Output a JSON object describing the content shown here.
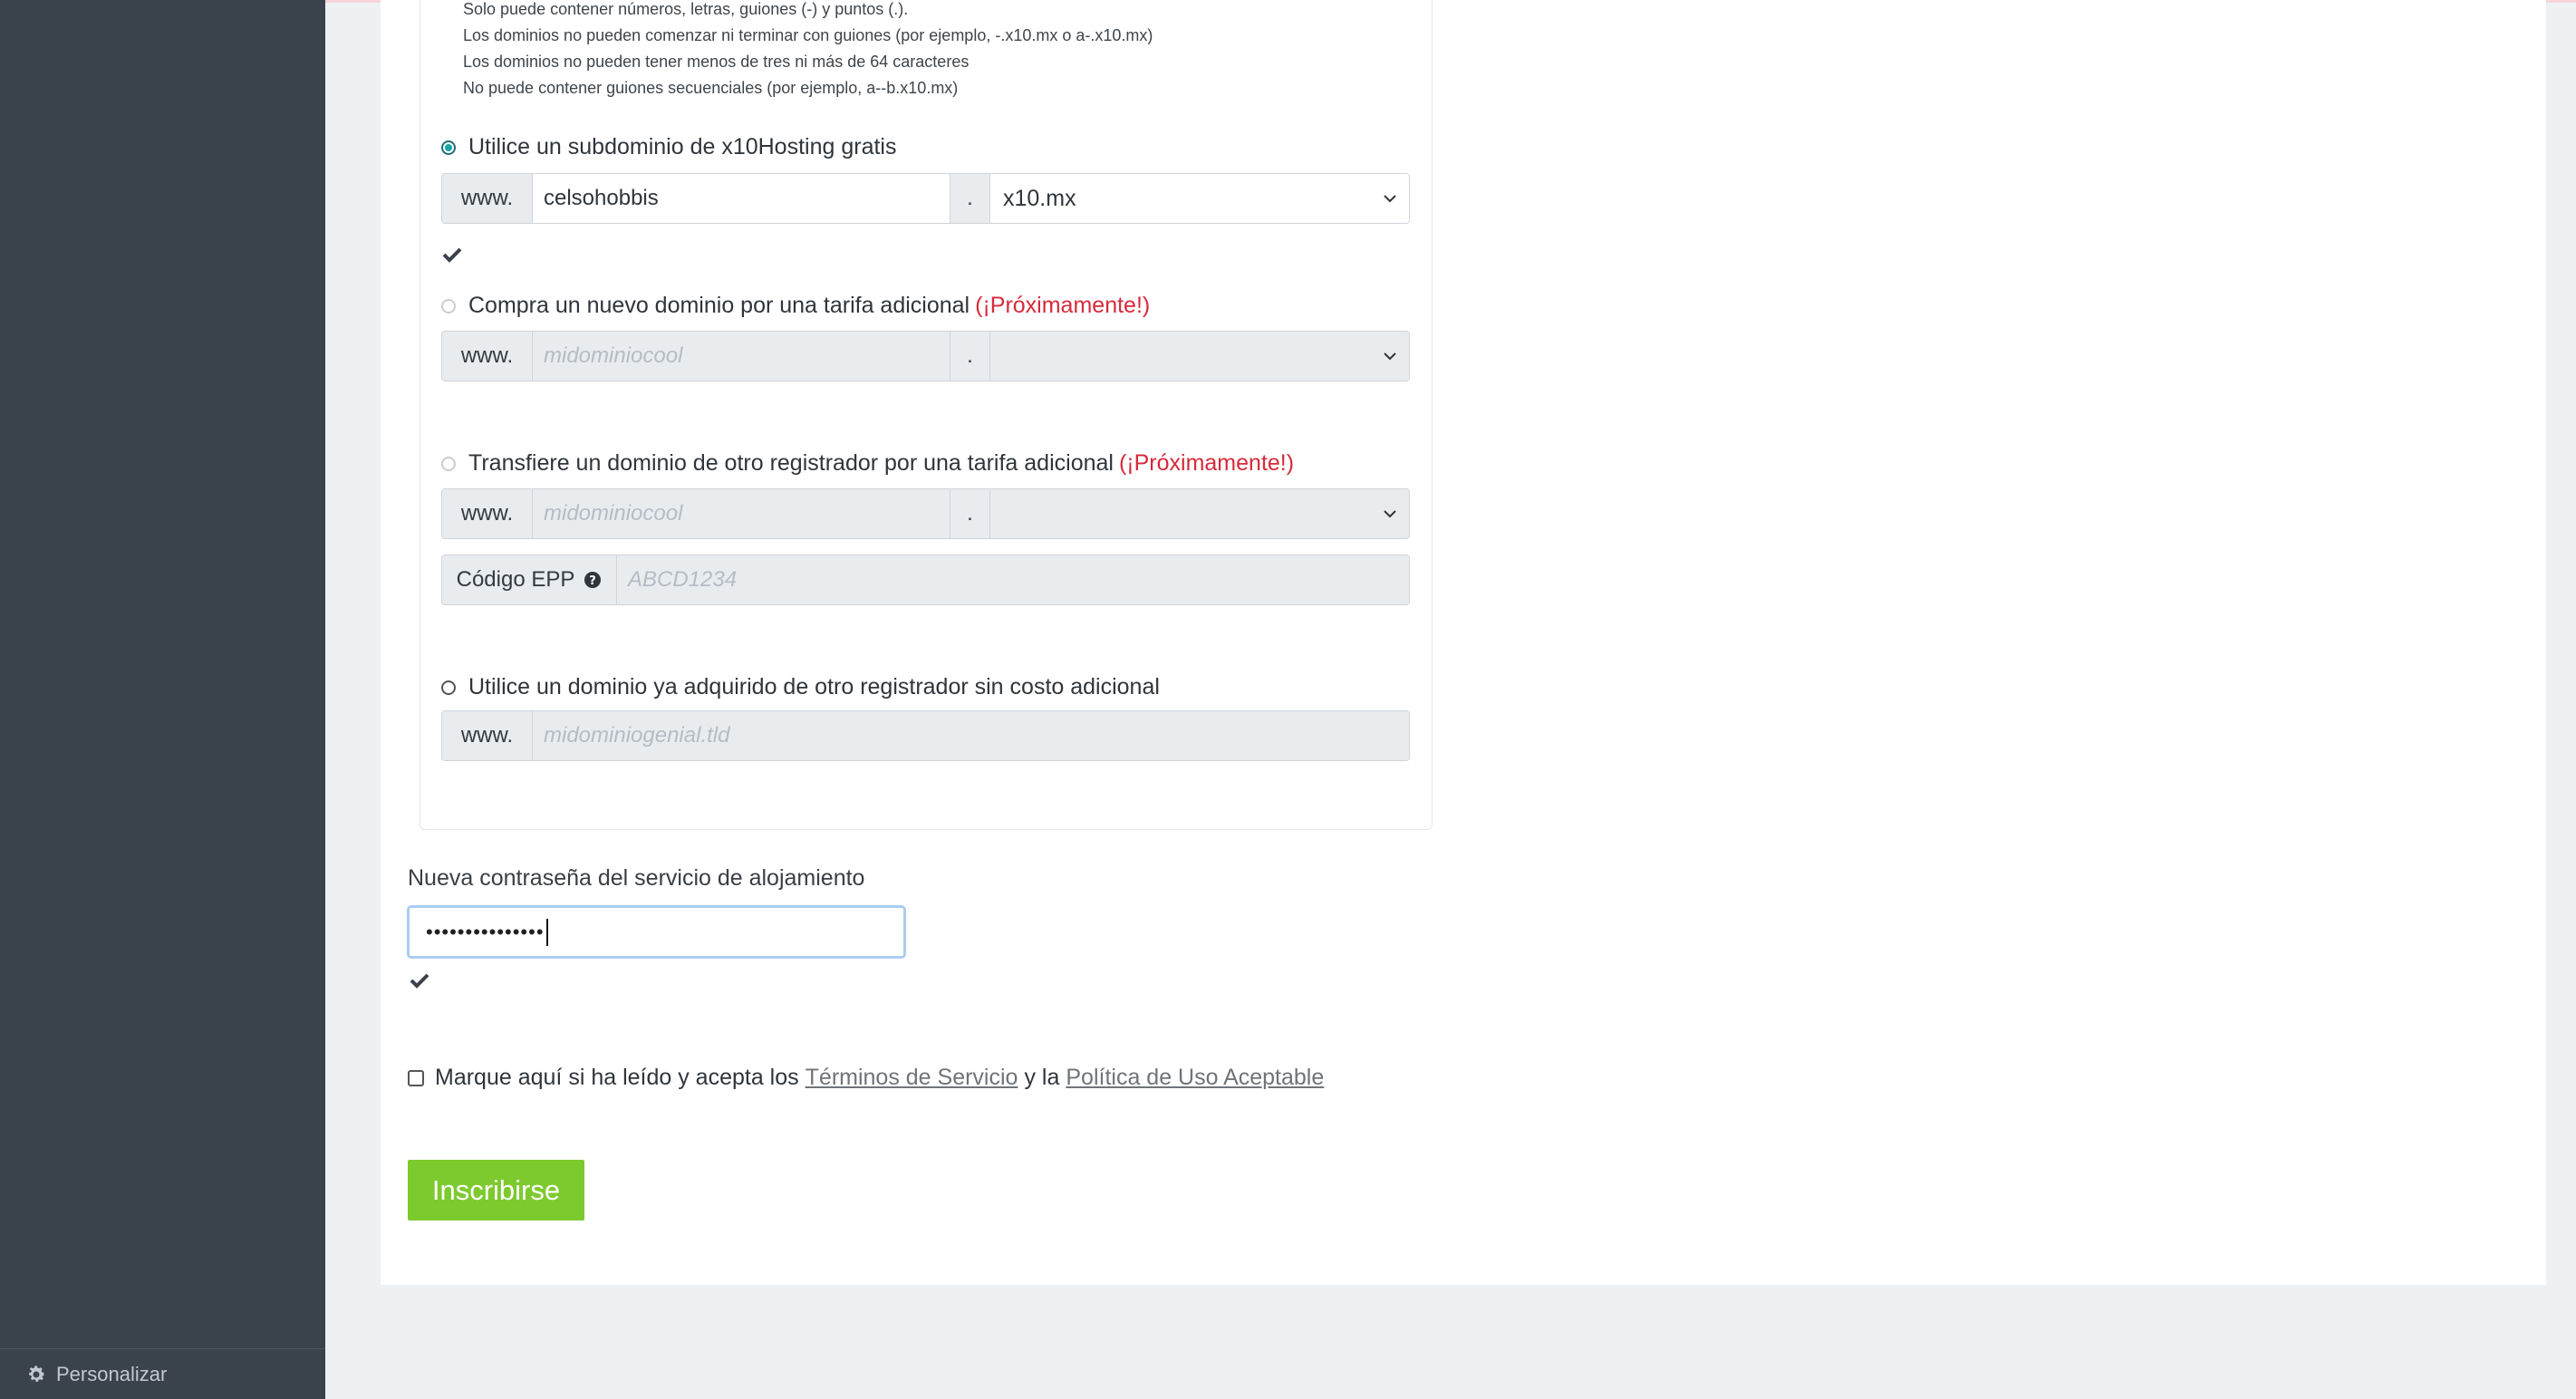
{
  "sidebar": {
    "footer_label": "Personalizar"
  },
  "rules": [
    "Solo puede contener números, letras, guiones (-) y puntos (.).",
    "Los dominios no pueden comenzar ni terminar con guiones (por ejemplo, -.x10.mx o a-.x10.mx)",
    "Los dominios no pueden tener menos de tres ni más de 64 caracteres",
    "No puede contener guiones secuenciales (por ejemplo, a--b.x10.mx)"
  ],
  "options": {
    "subdomain": {
      "label": "Utilice un subdominio de x10Hosting gratis",
      "prefix": "www.",
      "value": "celsohobbis",
      "dot": ".",
      "tld": "x10.mx"
    },
    "new_domain": {
      "label": "Compra un nuevo dominio por una tarifa adicional",
      "soon": "(¡Próximamente!)",
      "prefix": "www.",
      "placeholder": "midominiocool",
      "dot": "."
    },
    "transfer": {
      "label": "Transfiere un dominio de otro registrador por una tarifa adicional",
      "soon": "(¡Próximamente!)",
      "prefix": "www.",
      "placeholder": "midominiocool",
      "dot": ".",
      "epp_label": "Código EPP",
      "epp_placeholder": "ABCD1234"
    },
    "existing": {
      "label": "Utilice un dominio ya adquirido de otro registrador sin costo adicional",
      "prefix": "www.",
      "placeholder": "midominiogenial.tld"
    }
  },
  "password": {
    "label": "Nueva contraseña del servicio de alojamiento",
    "value": "•••••••••••••••"
  },
  "terms": {
    "before": "Marque aquí si ha leído y acepta los",
    "tos_link": "Términos de Servicio",
    "middle": "y la",
    "aup_link": "Política de Uso Aceptable"
  },
  "submit_label": "Inscribirse",
  "colors": {
    "sidebar": "#3a424c",
    "accent_green": "#7dca2e",
    "soon_red": "#d62a3a",
    "radio_teal": "#1aa5a8"
  }
}
